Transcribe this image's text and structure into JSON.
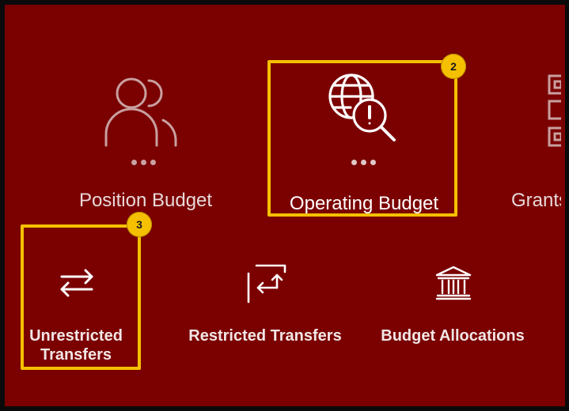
{
  "tiles_row1": [
    {
      "label": "Position Budget",
      "icon": "people-icon",
      "menu": "more-dots"
    },
    {
      "label": "Operating Budget",
      "icon": "globe-search-alert-icon",
      "menu": "more-dots"
    },
    {
      "label": "Grants",
      "icon": "checklist-icon"
    }
  ],
  "tiles_row2": [
    {
      "label_line1": "Unrestricted",
      "label_line2": "Transfers",
      "icon": "swap-arrows-icon"
    },
    {
      "label": "Restricted Transfers",
      "icon": "restricted-transfer-icon"
    },
    {
      "label": "Budget Allocations",
      "icon": "bank-building-icon"
    }
  ],
  "annotations": {
    "badge_operating": "2",
    "badge_unrestricted": "3"
  },
  "colors": {
    "background": "#7b0000",
    "highlight": "#f5c000",
    "text": "#e9dada"
  }
}
